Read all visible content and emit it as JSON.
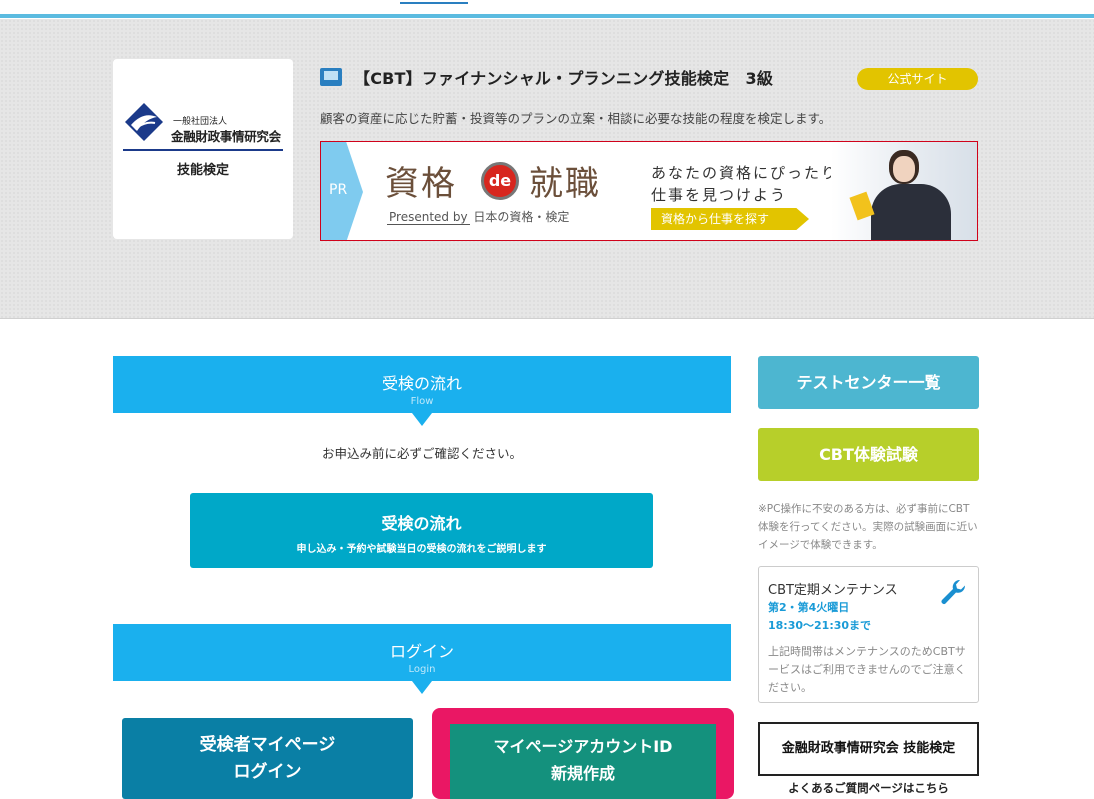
{
  "header": {
    "exam_title": "【CBT】ファイナンシャル・プランニング技能検定　3級",
    "official_site_label": "公式サイト",
    "description": "顧客の資産に応じた貯蓄・投資等のプランの立案・相談に必要な技能の程度を検定します。"
  },
  "logo": {
    "org_small": "一般社団法人",
    "org_name": "金融財政事情研究会",
    "sub": "技能検定"
  },
  "pr_banner": {
    "pr_label": "PR",
    "logo_left": "資格",
    "logo_center": "de",
    "logo_right": "就職",
    "presented_by": "Presented by",
    "presented_org": "日本の資格・検定",
    "copy_line1": "あなたの資格にぴったりな",
    "copy_line2": "仕事を見つけよう",
    "cta": "資格から仕事を探す"
  },
  "flow_section": {
    "title": "受検の流れ",
    "subtitle": "Flow",
    "notice": "お申込み前に必ずご確認ください。",
    "button_title": "受検の流れ",
    "button_sub": "申し込み・予約や試験当日の受検の流れをご説明します"
  },
  "login_section": {
    "title": "ログイン",
    "subtitle": "Login",
    "mypage_login_line1": "受検者マイページ",
    "mypage_login_line2": "ログイン",
    "new_account_line1": "マイページアカウントID",
    "new_account_line2": "新規作成"
  },
  "sidebar": {
    "test_center_label": "テストセンター一覧",
    "cbt_trial_label": "CBT体験試験",
    "note": "※PC操作に不安のある方は、必ず事前にCBT体験を行ってください。実際の試験画面に近いイメージで体験できます。",
    "maintenance": {
      "title": "CBT定期メンテナンス",
      "days": "第2・第4火曜日",
      "time": "18:30～21:30まで",
      "note": "上記時間帯はメンテナンスのためCBTサービスはご利用できませんのでご注意ください。"
    },
    "faq_box": "金融財政事情研究会 技能検定",
    "faq_link": "よくあるご質問ページはこちら"
  },
  "colors": {
    "accent_blue": "#1ab0ee",
    "flow_button": "#00a8c8",
    "login_button": "#0a7fa5",
    "new_account_border": "#ea1764",
    "new_account_button": "#14917d",
    "test_center": "#4db6d0",
    "cbt_trial": "#b7cf2a",
    "official_badge": "#e2c400"
  },
  "icons": {
    "pc": "computer-icon",
    "wrench": "wrench-icon",
    "logo_mark": "kinzai-logo-icon"
  }
}
